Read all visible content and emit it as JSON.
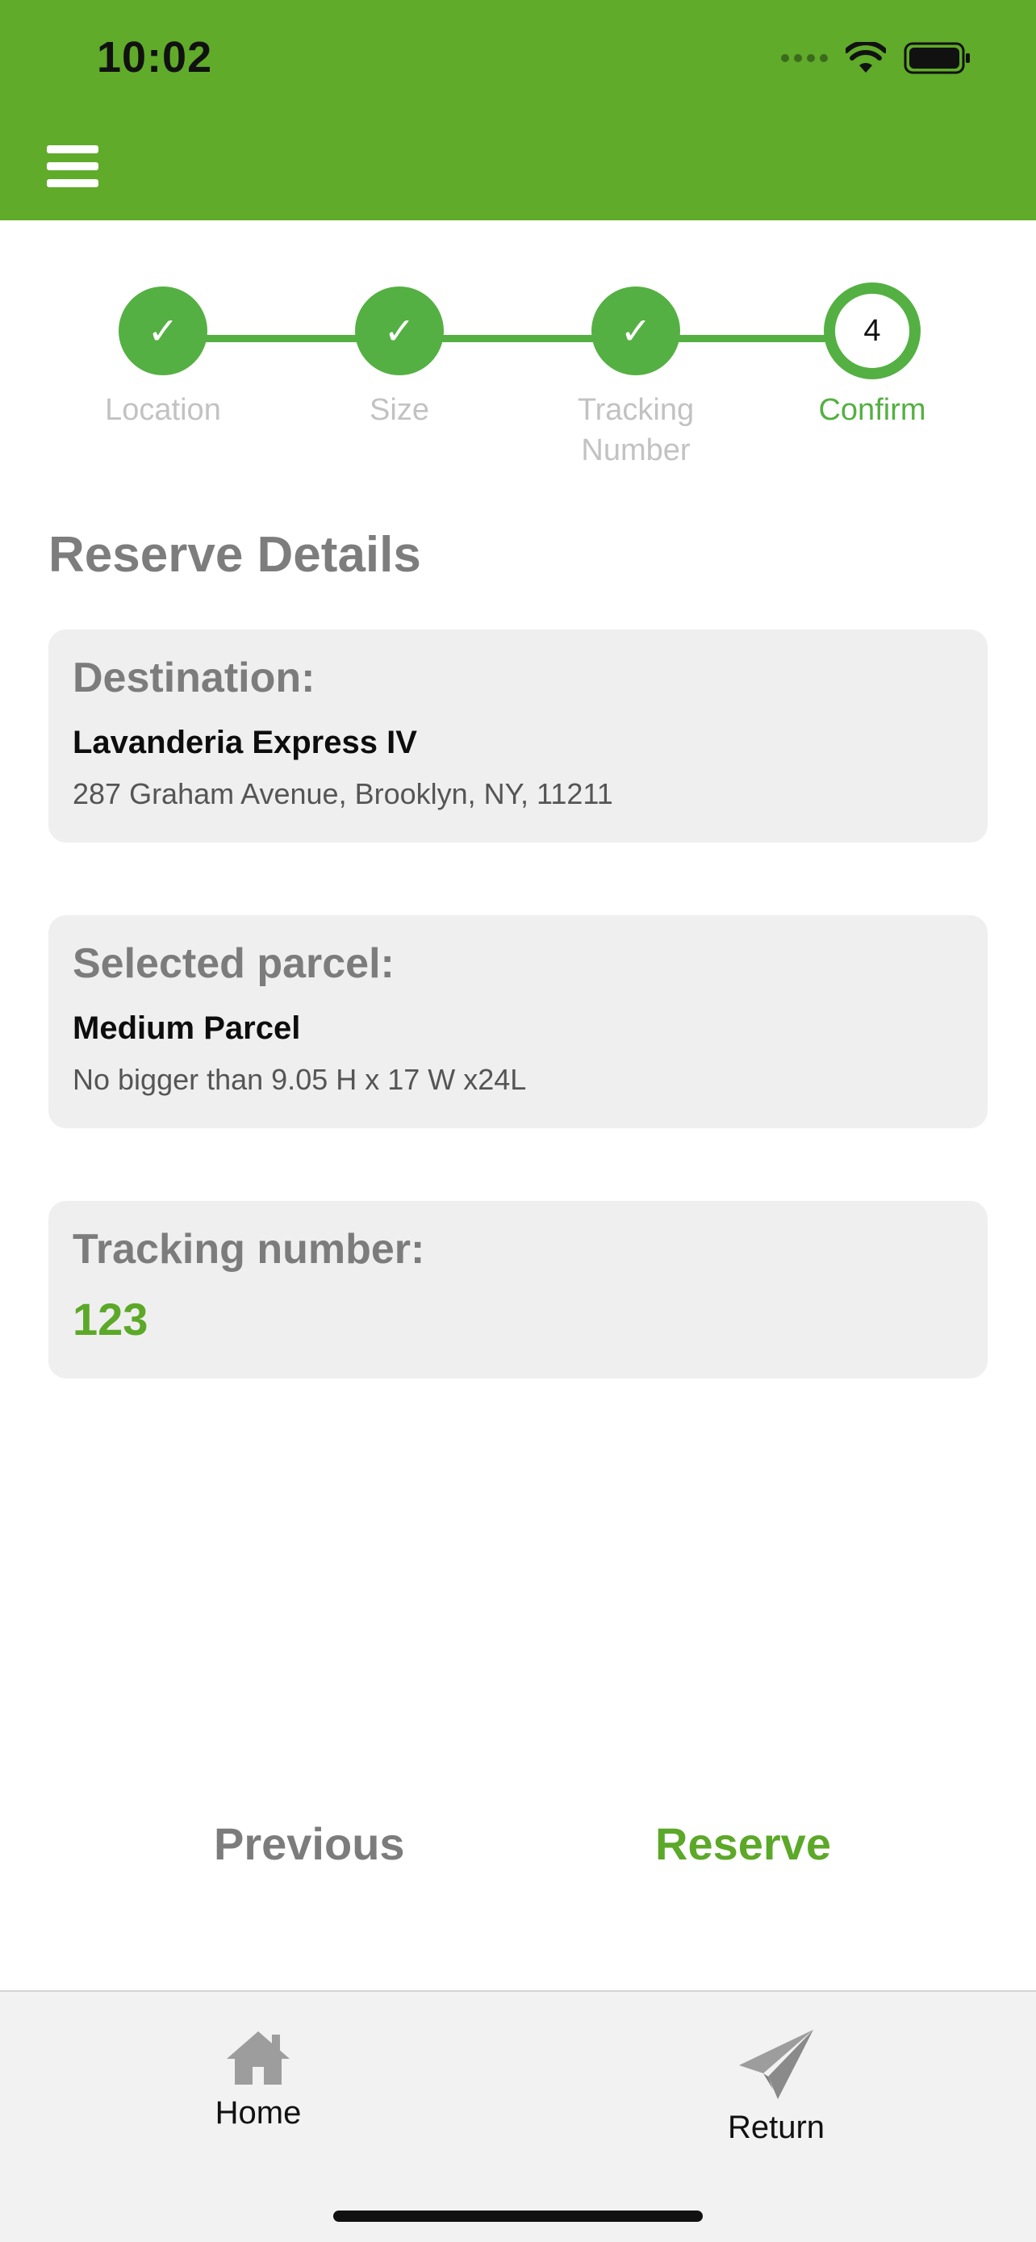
{
  "status_bar": {
    "time": "10:02"
  },
  "stepper": {
    "steps": [
      {
        "label": "Location",
        "state": "done"
      },
      {
        "label": "Size",
        "state": "done"
      },
      {
        "label": "Tracking\nNumber",
        "state": "done"
      },
      {
        "label": "Confirm",
        "state": "active",
        "number": "4"
      }
    ]
  },
  "main": {
    "title": "Reserve Details",
    "destination": {
      "label": "Destination:",
      "name": "Lavanderia Express IV",
      "address": "287 Graham Avenue, Brooklyn, NY, 11211"
    },
    "parcel": {
      "label": "Selected parcel:",
      "name": "Medium Parcel",
      "size": "No bigger than 9.05 H x 17 W x24L"
    },
    "tracking": {
      "label": "Tracking number:",
      "value": "123"
    }
  },
  "actions": {
    "previous": "Previous",
    "reserve": "Reserve"
  },
  "tabbar": {
    "items": [
      {
        "label": "Home",
        "icon": "home-icon"
      },
      {
        "label": "Return",
        "icon": "paper-plane-icon"
      }
    ]
  },
  "colors": {
    "brand": "#60ab2a",
    "accent": "#54b042",
    "card": "#efefef"
  }
}
